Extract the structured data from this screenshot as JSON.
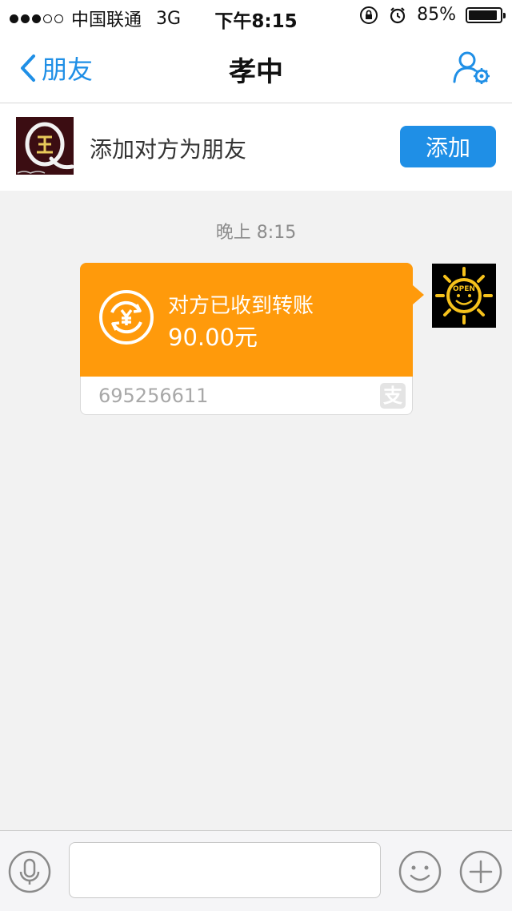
{
  "status_bar": {
    "carrier": "中国联通",
    "network": "3G",
    "time": "下午8:15",
    "battery": "85%"
  },
  "nav": {
    "back_label": "朋友",
    "title": "孝中",
    "settings_icon": "user-settings-icon"
  },
  "add_friend": {
    "text": "添加对方为朋友",
    "button_label": "添加"
  },
  "chat": {
    "timestamp": "晚上 8:15",
    "transfer": {
      "status": "对方已收到转账",
      "amount": "90.00元",
      "id": "695256611",
      "brand_glyph": "支"
    },
    "my_avatar_text": "OPEN"
  },
  "input_bar": {
    "placeholder": ""
  },
  "colors": {
    "accent": "#1f8fe6",
    "transfer": "#ff9a0b",
    "background": "#f2f2f2"
  }
}
